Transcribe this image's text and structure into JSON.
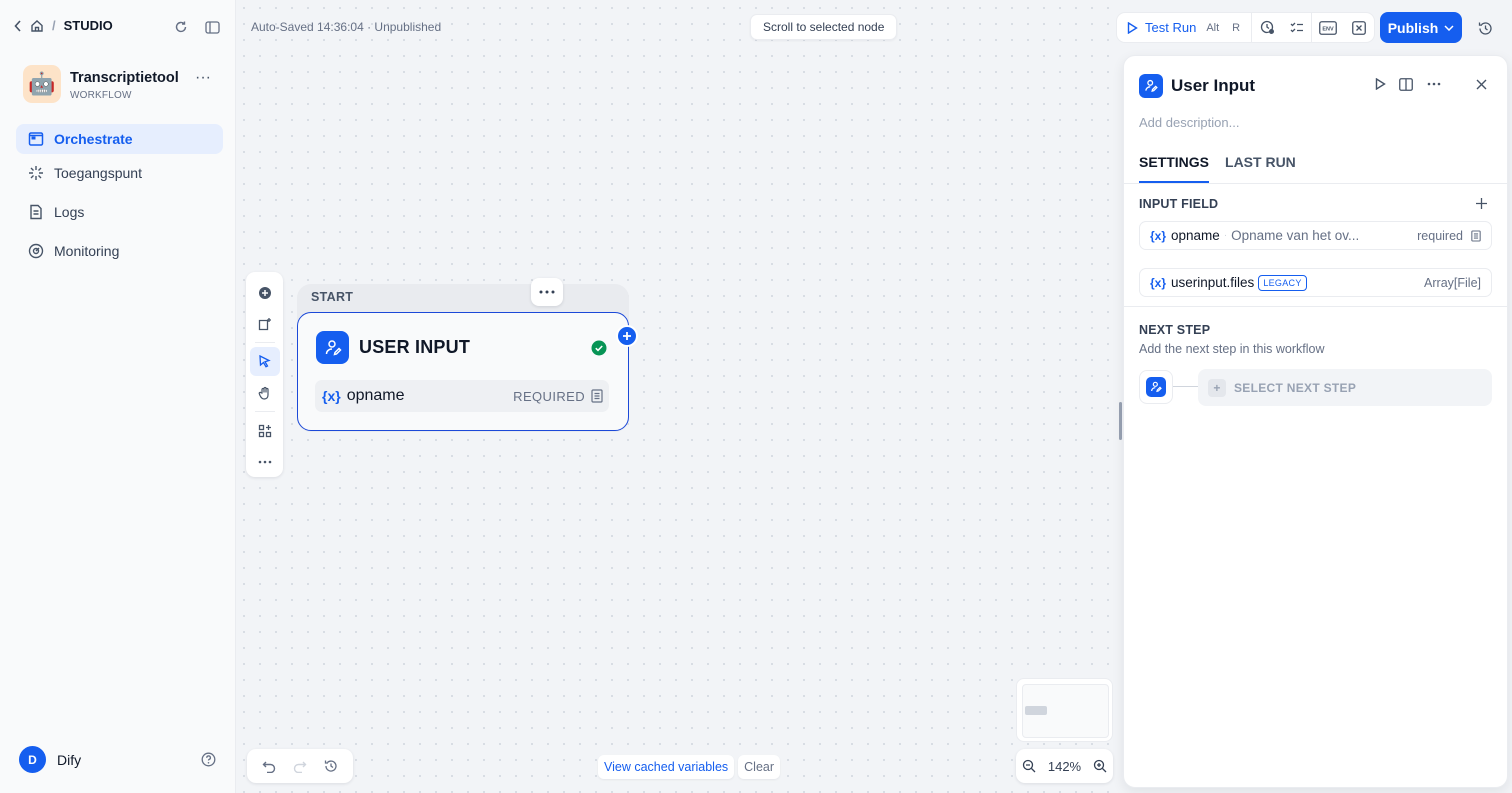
{
  "breadcrumb": {
    "studio": "STUDIO"
  },
  "app": {
    "name": "Transcriptietool",
    "type": "WORKFLOW",
    "avatar_emoji": "🤖"
  },
  "nav": [
    {
      "label": "Orchestrate",
      "icon": "orchestrate-icon",
      "active": true
    },
    {
      "label": "Toegangspunt",
      "icon": "access-point-icon",
      "active": false
    },
    {
      "label": "Logs",
      "icon": "logs-icon",
      "active": false
    },
    {
      "label": "Monitoring",
      "icon": "monitoring-icon",
      "active": false
    }
  ],
  "user": {
    "initial": "D",
    "name": "Dify"
  },
  "canvas": {
    "autosave": "Auto-Saved 14:36:04 · Unpublished",
    "scroll_button": "Scroll to selected node",
    "zoom": "142%",
    "view_cached": "View cached variables",
    "clear": "Clear"
  },
  "node": {
    "label": "START",
    "title": "USER INPUT",
    "var_icon": "{x}",
    "var_name": "opname",
    "required": "REQUIRED"
  },
  "topbar": {
    "test_run": "Test Run",
    "shortcut_alt": "Alt",
    "shortcut_key": "R",
    "env": "ENV",
    "publish": "Publish"
  },
  "panel": {
    "title": "User Input",
    "description_placeholder": "Add description...",
    "tabs": [
      "SETTINGS",
      "LAST RUN"
    ],
    "input_field_heading": "INPUT FIELD",
    "fields": [
      {
        "icon": "{x}",
        "name": "opname",
        "desc": "Opname van het ov...",
        "meta": "required"
      },
      {
        "icon": "{x}",
        "name": "userinput.files",
        "badge": "LEGACY",
        "meta": "Array[File]"
      }
    ],
    "next_step_heading": "NEXT STEP",
    "next_step_desc": "Add the next step in this workflow",
    "select_next_step": "SELECT NEXT STEP"
  },
  "colors": {
    "accent": "#155eef",
    "success": "#079455",
    "brand_bg": "#f2f4f7"
  }
}
